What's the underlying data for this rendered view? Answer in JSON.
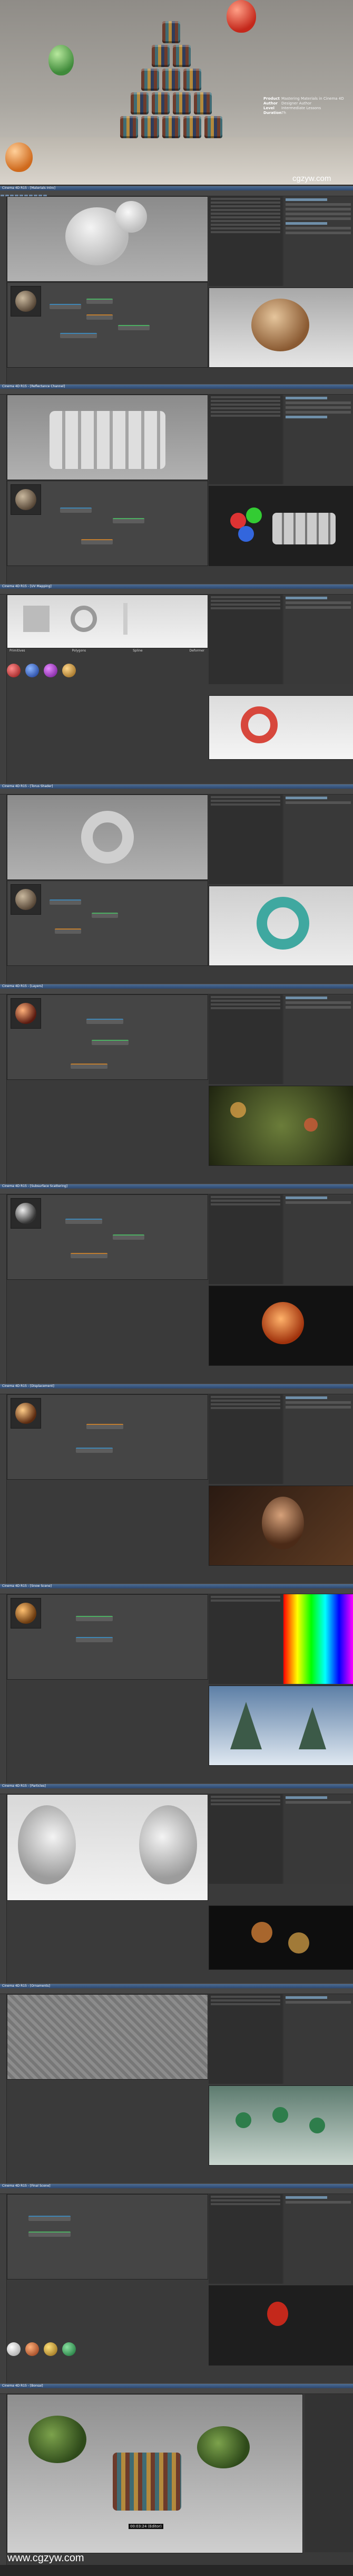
{
  "hero": {
    "info": [
      {
        "label": "Product",
        "value": "Mastering Materials in Cinema 4D"
      },
      {
        "label": "Author",
        "value": "Designer Author"
      },
      {
        "label": "Level",
        "value": "Intermediate Lessons"
      },
      {
        "label": "Duration",
        "value": "7h"
      }
    ],
    "watermark": "cgzyw.com"
  },
  "sections": [
    {
      "id": "s1",
      "title": "Cinema 4D R15 - [Materials Intro]"
    },
    {
      "id": "s2",
      "title": "Cinema 4D R15 - [Reflectance Channel]"
    },
    {
      "id": "s3",
      "title": "Cinema 4D R15 - [UV Mapping]"
    },
    {
      "id": "s4",
      "title": "Cinema 4D R15 - [Torus Shader]"
    },
    {
      "id": "s5",
      "title": "Cinema 4D R15 - [Layers]"
    },
    {
      "id": "s6",
      "title": "Cinema 4D R15 - [Subsurface Scattering]"
    },
    {
      "id": "s7",
      "title": "Cinema 4D R15 - [Displacement]"
    },
    {
      "id": "s8",
      "title": "Cinema 4D R15 - [Snow Scene]"
    },
    {
      "id": "s9",
      "title": "Cinema 4D R15 - [Particles]"
    },
    {
      "id": "s10",
      "title": "Cinema 4D R15 - [Ornaments]"
    },
    {
      "id": "s11",
      "title": "Cinema 4D R15 - [Final Scene]"
    },
    {
      "id": "s12",
      "title": "Cinema 4D R15 - [Bonsai]"
    }
  ],
  "uv_labels": [
    "Primitives",
    "Polygons",
    "Spline",
    "Deformer"
  ],
  "footer_watermark": "www.cgzyw.com",
  "render_badge": "00:03:24 (Editor)"
}
